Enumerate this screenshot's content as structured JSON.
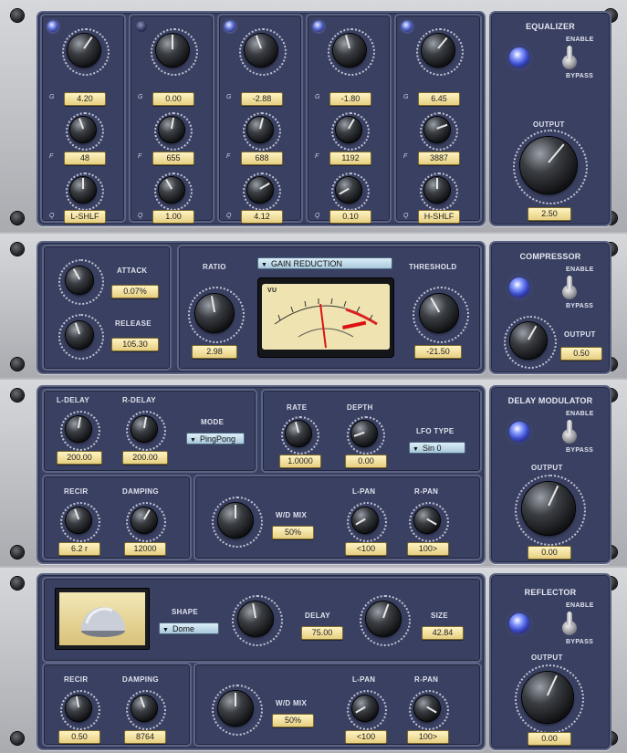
{
  "equalizer": {
    "title": "EQUALIZER",
    "enable": "ENABLE",
    "bypass": "BYPASS",
    "output_label": "OUTPUT",
    "output_value": "2.50",
    "row_labels": {
      "gain": "G",
      "freq": "F",
      "q": "Q"
    },
    "bands": [
      {
        "gain": "4.20",
        "freq": "48",
        "q": "L-SHLF"
      },
      {
        "gain": "0.00",
        "freq": "655",
        "q": "1.00"
      },
      {
        "gain": "-2.88",
        "freq": "688",
        "q": "4.12"
      },
      {
        "gain": "-1.80",
        "freq": "1192",
        "q": "0.10"
      },
      {
        "gain": "6.45",
        "freq": "3887",
        "q": "H-SHLF"
      }
    ]
  },
  "compressor": {
    "title": "COMPRESSOR",
    "enable": "ENABLE",
    "bypass": "BYPASS",
    "attack_label": "ATTACK",
    "attack_value": "0.07%",
    "release_label": "RELEASE",
    "release_value": "105.30",
    "ratio_label": "RATIO",
    "ratio_value": "2.98",
    "meter_select": "GAIN REDUCTION",
    "threshold_label": "THRESHOLD",
    "threshold_value": "-21.50",
    "output_label": "OUTPUT",
    "output_value": "0.50",
    "vu_label": "VU"
  },
  "delay_modulator": {
    "title": "DELAY MODULATOR",
    "enable": "ENABLE",
    "bypass": "BYPASS",
    "l_delay_label": "L-DELAY",
    "l_delay_value": "200.00",
    "r_delay_label": "R-DELAY",
    "r_delay_value": "200.00",
    "mode_label": "MODE",
    "mode_value": "PingPong",
    "rate_label": "RATE",
    "rate_value": "1.0000",
    "depth_label": "DEPTH",
    "depth_value": "0.00",
    "lfo_label": "LFO TYPE",
    "lfo_value": "Sin 0",
    "recir_label": "RECIR",
    "recir_value": "6.2 r",
    "damping_label": "DAMPING",
    "damping_value": "12000",
    "wd_label": "W/D MIX",
    "wd_value": "50%",
    "lpan_label": "L-PAN",
    "lpan_value": "<100",
    "rpan_label": "R-PAN",
    "rpan_value": "100>",
    "output_label": "OUTPUT",
    "output_value": "0.00"
  },
  "reflector": {
    "title": "REFLECTOR",
    "enable": "ENABLE",
    "bypass": "BYPASS",
    "shape_label": "SHAPE",
    "shape_value": "Dome",
    "delay_label": "DELAY",
    "delay_value": "75.00",
    "size_label": "SIZE",
    "size_value": "42.84",
    "recir_label": "RECIR",
    "recir_value": "0.50",
    "damping_label": "DAMPING",
    "damping_value": "8764",
    "wd_label": "W/D MIX",
    "wd_value": "50%",
    "lpan_label": "L-PAN",
    "lpan_value": "<100",
    "rpan_label": "R-PAN",
    "rpan_value": "100>",
    "output_label": "OUTPUT",
    "output_value": "0.00"
  },
  "colors": {
    "panel": "#3a4061",
    "value_bg": "#f2e3a0",
    "led": "#5b6ed8"
  }
}
